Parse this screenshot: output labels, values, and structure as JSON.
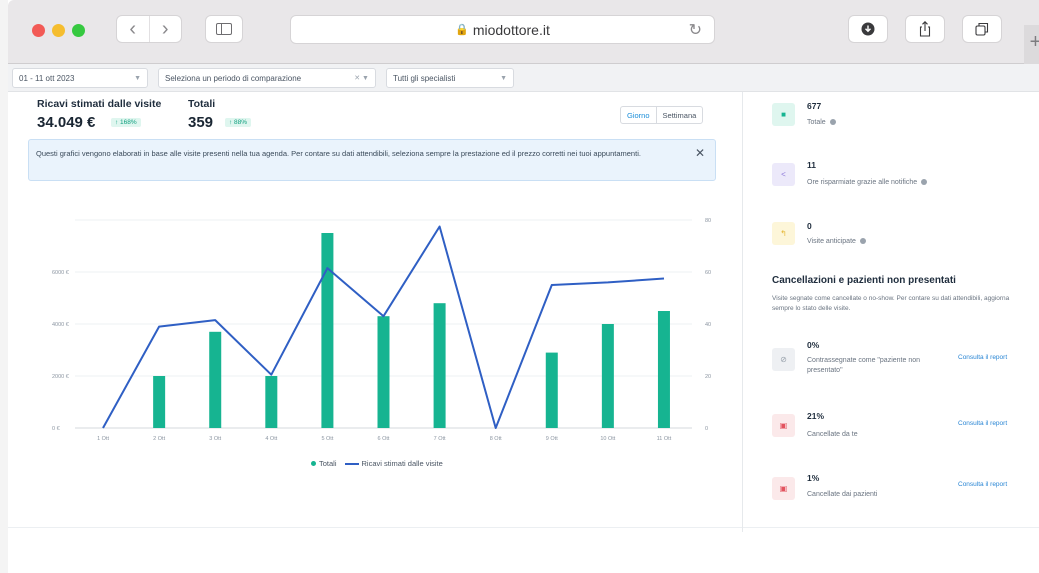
{
  "browser": {
    "url": "miodottore.it",
    "back_icon": "‹",
    "forward_icon": "›",
    "plus": "+"
  },
  "filters": {
    "date_range": "01 - 11 ott 2023",
    "compare": "Seleziona un periodo di comparazione",
    "specialists": "Tutti gli specialisti"
  },
  "stats": {
    "revenue_label": "Ricavi stimati dalle visite",
    "revenue_value": "34.049 €",
    "revenue_badge": "↑ 168%",
    "total_label": "Totali",
    "total_value": "359",
    "total_badge": "↑ 88%"
  },
  "period_toggle": {
    "day": "Giorno",
    "week": "Settimana"
  },
  "info_box": {
    "text": "Questi grafici vengono elaborati in base alle visite presenti nella tua agenda. Per contare su dati attendibili, seleziona sempre la prestazione ed il prezzo corretti nei tuoi appuntamenti.",
    "close": "✕"
  },
  "chart_data": {
    "type": "bar",
    "categories": [
      "1 Ott",
      "2 Ott",
      "3 Ott",
      "4 Ott",
      "5 Ott",
      "6 Ott",
      "7 Ott",
      "8 Ott",
      "9 Ott",
      "10 Ott",
      "11 Ott"
    ],
    "left_axis_ticks": [
      "0 €",
      "2000 €",
      "4000 €",
      "6000 €"
    ],
    "right_axis_ticks": [
      "0",
      "20",
      "40",
      "60",
      "80"
    ],
    "series": [
      {
        "name": "Totali",
        "type": "bar",
        "axis": "right",
        "color": "#16b491",
        "values": [
          0,
          20,
          37,
          20,
          75,
          43,
          48,
          0,
          29,
          40,
          45
        ]
      },
      {
        "name": "Ricavi stimati dalle visite",
        "type": "line",
        "axis": "left",
        "color": "#2f5fc4",
        "values": [
          0,
          3900,
          4150,
          2050,
          6150,
          4300,
          7750,
          0,
          5500,
          5600,
          5750
        ]
      }
    ],
    "ylim_left": [
      0,
      8000
    ],
    "ylim_right": [
      0,
      80
    ],
    "grid": true,
    "legend_placement": "bottom"
  },
  "right_panel": {
    "items": [
      {
        "value": "677",
        "label": "Totale",
        "icon_color": "#dff6ef",
        "icon_fg": "#16b491",
        "icon": "■"
      },
      {
        "value": "11",
        "label": "Ore risparmiate grazie alle notifiche",
        "icon_color": "#ece9fa",
        "icon_fg": "#8e7ad9",
        "icon": "<"
      },
      {
        "value": "0",
        "label": "Visite anticipate",
        "icon_color": "#fdf6d9",
        "icon_fg": "#e6b93a",
        "icon": "↰"
      }
    ],
    "section_title": "Cancellazioni e pazienti non presentati",
    "section_desc": "Visite segnate come cancellate o no-show. Per contare su dati attendibili, aggiorna sempre lo stato delle visite.",
    "cancellations": [
      {
        "percent": "0%",
        "label": "Contrassegnate come \"paziente non presentato\"",
        "link": "Consulta il report",
        "icon_color": "#eef0f3",
        "icon_fg": "#9aa3ad",
        "icon": "⊘"
      },
      {
        "percent": "21%",
        "label": "Cancellate da te",
        "link": "Consulta il report",
        "icon_color": "#fbe9ea",
        "icon_fg": "#e2535f",
        "icon": "▣"
      },
      {
        "percent": "1%",
        "label": "Cancellate dai pazienti",
        "link": "Consulta il report",
        "icon_color": "#fbe9ea",
        "icon_fg": "#e2535f",
        "icon": "▣"
      }
    ]
  }
}
